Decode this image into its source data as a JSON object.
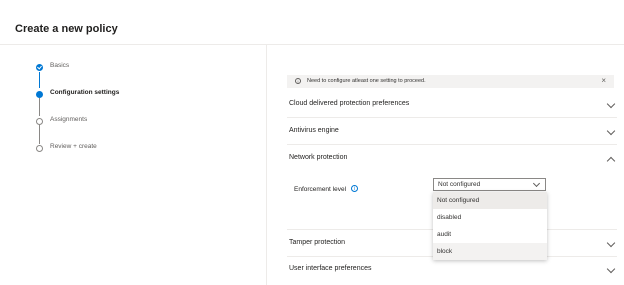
{
  "page": {
    "title": "Create a new policy"
  },
  "wizard": {
    "steps": [
      {
        "label": "Basics",
        "state": "done"
      },
      {
        "label": "Configuration settings",
        "state": "current"
      },
      {
        "label": "Assignments",
        "state": "todo"
      },
      {
        "label": "Review + create",
        "state": "todo"
      }
    ]
  },
  "info_bar": {
    "icon": "info-icon",
    "message": "Need to configure atleast one setting to proceed.",
    "close_glyph": "×"
  },
  "sections": {
    "cloud": {
      "title": "Cloud delivered protection preferences",
      "expanded": false
    },
    "antivirus": {
      "title": "Antivirus engine",
      "expanded": false
    },
    "network": {
      "title": "Network protection",
      "expanded": true
    },
    "tamper": {
      "title": "Tamper protection",
      "expanded": false
    },
    "ui_prefs": {
      "title": "User interface preferences",
      "expanded": false
    }
  },
  "enforcement": {
    "label": "Enforcement level",
    "info_glyph": "i",
    "selected_value": "Not configured",
    "options": [
      "Not configured",
      "disabled",
      "audit",
      "block"
    ]
  },
  "colors": {
    "accent": "#0078d4",
    "divider": "#edebe9",
    "selected_option": "#edebe9"
  }
}
